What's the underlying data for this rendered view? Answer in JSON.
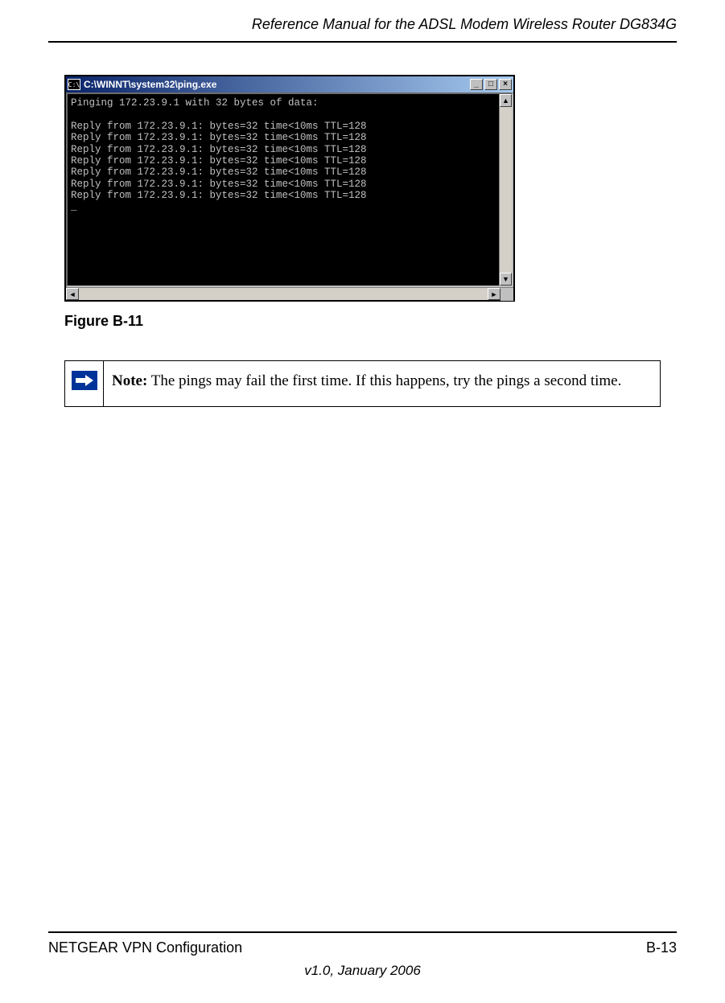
{
  "header": {
    "title": "Reference Manual for the ADSL Modem Wireless Router DG834G"
  },
  "screenshot": {
    "window_title": "C:\\WINNT\\system32\\ping.exe",
    "console_lines": [
      "Pinging 172.23.9.1 with 32 bytes of data:",
      "",
      "Reply from 172.23.9.1: bytes=32 time<10ms TTL=128",
      "Reply from 172.23.9.1: bytes=32 time<10ms TTL=128",
      "Reply from 172.23.9.1: bytes=32 time<10ms TTL=128",
      "Reply from 172.23.9.1: bytes=32 time<10ms TTL=128",
      "Reply from 172.23.9.1: bytes=32 time<10ms TTL=128",
      "Reply from 172.23.9.1: bytes=32 time<10ms TTL=128",
      "Reply from 172.23.9.1: bytes=32 time<10ms TTL=128",
      "_"
    ]
  },
  "figure": {
    "caption": "Figure B-11"
  },
  "note": {
    "label": "Note:",
    "text": " The pings may fail the first time. If this happens, try the pings a second time."
  },
  "footer": {
    "left": "NETGEAR VPN Configuration",
    "right": "B-13",
    "version": "v1.0, January 2006"
  }
}
